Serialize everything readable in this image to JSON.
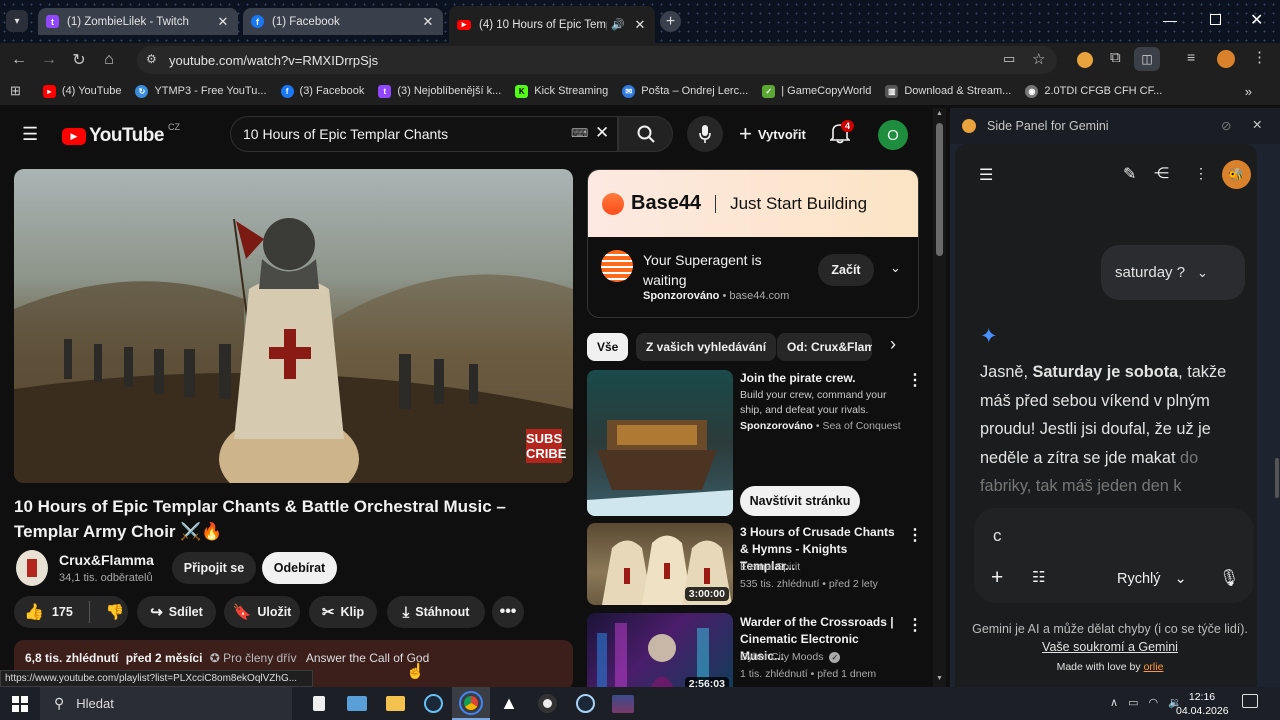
{
  "tabs": [
    {
      "title": "(1) ZombieLilek - Twitch",
      "favicon": "twitch-icon"
    },
    {
      "title": "(1) Facebook",
      "favicon": "facebook-icon"
    },
    {
      "title": "(4) 10 Hours of Epic Templar",
      "favicon": "youtube-icon",
      "active": true
    }
  ],
  "address": {
    "url": "youtube.com/watch?v=RMXIDrrpSjs"
  },
  "bookmarks": [
    {
      "label": "(4) YouTube",
      "icon": "youtube-icon"
    },
    {
      "label": "YTMP3 - Free YouTu...",
      "icon": "ytmp3-icon"
    },
    {
      "label": "(3) Facebook",
      "icon": "facebook-icon"
    },
    {
      "label": "(3) Nejoblíbenější k...",
      "icon": "twitch-icon"
    },
    {
      "label": "Kick Streaming",
      "icon": "kick-icon"
    },
    {
      "label": "Pošta – Ondrej Lerc...",
      "icon": "mail-icon"
    },
    {
      "label": "| GameCopyWorld",
      "icon": "gcw-icon"
    },
    {
      "label": "Download & Stream...",
      "icon": "archive-icon"
    },
    {
      "label": "2.0TDI CFGB CFH CF...",
      "icon": "globe-icon"
    }
  ],
  "youtube": {
    "logo_text": "YouTube",
    "country": "CZ",
    "search_value": "10 Hours of Epic Templar Chants",
    "create_label": "Vytvořit",
    "notif_count": "4",
    "avatar_letter": "O",
    "video": {
      "title": "10 Hours of Epic Templar Chants & Battle Orchestral Music – Templar Army Choir ⚔️🔥",
      "subscribe_overlay": "SUBS CRIBE",
      "channel": "Crux&Flamma",
      "subscribers": "34,1 tis. odběratelů",
      "join_label": "Připojit se",
      "subscribe_label": "Odebírat",
      "likes": "175",
      "share_label": "Sdílet",
      "save_label": "Uložit",
      "clip_label": "Klip",
      "download_label": "Stáhnout",
      "views": "6,8 tis. zhlédnutí",
      "date": "před 2 měsíci",
      "members_label": "Pro členy dřív",
      "desc_link": "Answer the Call of God"
    },
    "ad": {
      "banner_brand": "Base44",
      "banner_tag": "Just Start Building",
      "headline": "Your Superagent is waiting",
      "sponsored": "Sponzorováno",
      "domain": "base44.com",
      "cta": "Začít"
    },
    "chips": [
      "Vše",
      "Z vašich vyhledávání",
      "Od: Crux&Flamma"
    ],
    "recs": [
      {
        "title": "Join the pirate crew.",
        "desc": "Build your crew, command your ship, and defeat your rivals.",
        "sponsored": "Sponzorováno",
        "source": "Sea of Conquest",
        "cta": "Navštívit stránku"
      },
      {
        "title": "3 Hours of Crusade Chants & Hymns - Knights Templar...",
        "channel": "Eternal Spirit",
        "meta": "535 tis. zhlédnutí • před 2 lety",
        "duration": "3:00:00"
      },
      {
        "title": "Warder of the Crossroads | Cinematic Electronic Music...",
        "channel": "Cyber City Moods",
        "meta": "1 tis. zhlédnutí • před 1 dnem",
        "duration": "2:56:03"
      }
    ],
    "status_url": "https://www.youtube.com/playlist?list=PLXcciC8om8ekOqlVZhG..."
  },
  "gemini": {
    "header_title": "Side Panel for Gemini",
    "user_msg": "saturday ?",
    "reply_part1": "Jasně, ",
    "reply_bold": "Saturday je sobota",
    "reply_part2": ", takže máš před sebou víkend v plným proudu! Jestli jsi doufal, že už je neděle a zítra se jde makat",
    "reply_fade": "do fabriky, tak máš jeden den k",
    "input_value": "c",
    "model_label": "Rychlý",
    "disclaimer": "Gemini je AI a může dělat chyby (i co se týče lidí).",
    "privacy_link": "Vaše soukromí a Gemini",
    "made_with": "Made with love by ",
    "author": "orlie"
  },
  "taskbar": {
    "search_placeholder": "Hledat",
    "time": "12:16",
    "date": "04.04.2026"
  },
  "colors": {
    "accent_red": "#ff0000",
    "gemini_bg": "#1e2330",
    "yt_bg": "#0f0f0f"
  }
}
